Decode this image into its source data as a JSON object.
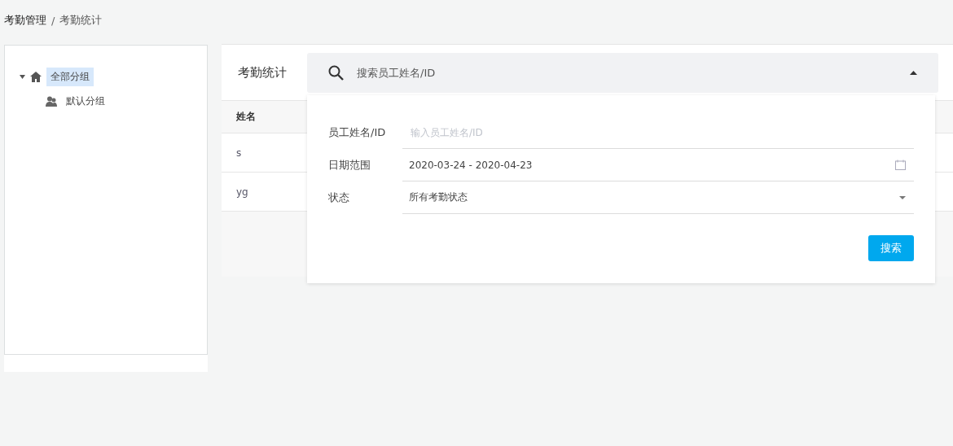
{
  "breadcrumb": [
    {
      "label": "考勤管理",
      "current": false
    },
    {
      "label": "考勤统计",
      "current": true
    }
  ],
  "breadcrumb_separator": "/",
  "tree": [
    {
      "label": "全部分组",
      "kind": "root",
      "selected": true,
      "expanded": true,
      "children": [
        {
          "label": "默认分组",
          "kind": "group",
          "selected": false
        }
      ]
    }
  ],
  "card": {
    "title": "考勤统计",
    "search": {
      "placeholder": "搜索员工姓名/ID",
      "expanded": true
    },
    "table": {
      "columns": [
        "姓名"
      ],
      "rows": [
        [
          "s"
        ],
        [
          "yg"
        ]
      ]
    }
  },
  "filter_panel": {
    "fields": [
      {
        "kind": "input",
        "label": "员工姓名/ID",
        "placeholder": "输入员工姓名/ID"
      },
      {
        "kind": "date",
        "label": "日期范围",
        "value": "2020-03-24 - 2020-04-23"
      },
      {
        "kind": "select",
        "label": "状态",
        "value": "所有考勤状态"
      }
    ],
    "button": "搜索"
  }
}
